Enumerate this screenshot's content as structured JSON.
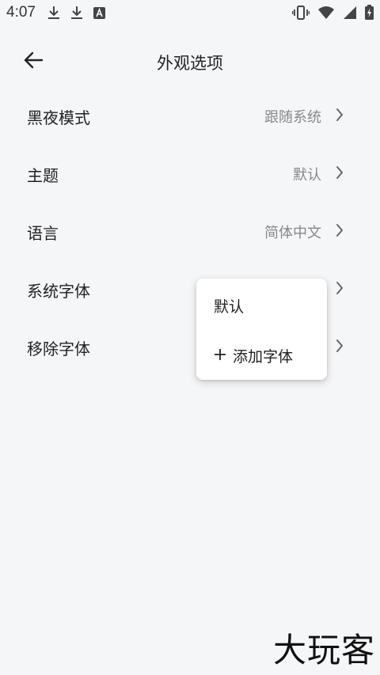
{
  "status_bar": {
    "time": "4:07",
    "left_icons": [
      "download-icon",
      "download-icon",
      "app-a-icon"
    ],
    "right_icons": [
      "vibrate-icon",
      "wifi-icon",
      "signal-icon",
      "battery-charging-icon"
    ]
  },
  "header": {
    "title": "外观选项",
    "back_icon": "arrow-left-icon"
  },
  "settings": {
    "items": [
      {
        "label": "黑夜模式",
        "value": "跟随系统"
      },
      {
        "label": "主题",
        "value": "默认"
      },
      {
        "label": "语言",
        "value": "简体中文"
      },
      {
        "label": "系统字体",
        "value": ""
      },
      {
        "label": "移除字体",
        "value": ""
      }
    ]
  },
  "popup_menu": {
    "options": [
      {
        "label": "默认"
      },
      {
        "label": "添加字体",
        "icon": "plus-icon"
      }
    ]
  },
  "watermark": {
    "text": "大玩客"
  },
  "colors": {
    "background": "#f5f6f8",
    "text_primary": "#222222",
    "text_secondary": "#888888",
    "popup_background": "#ffffff"
  }
}
